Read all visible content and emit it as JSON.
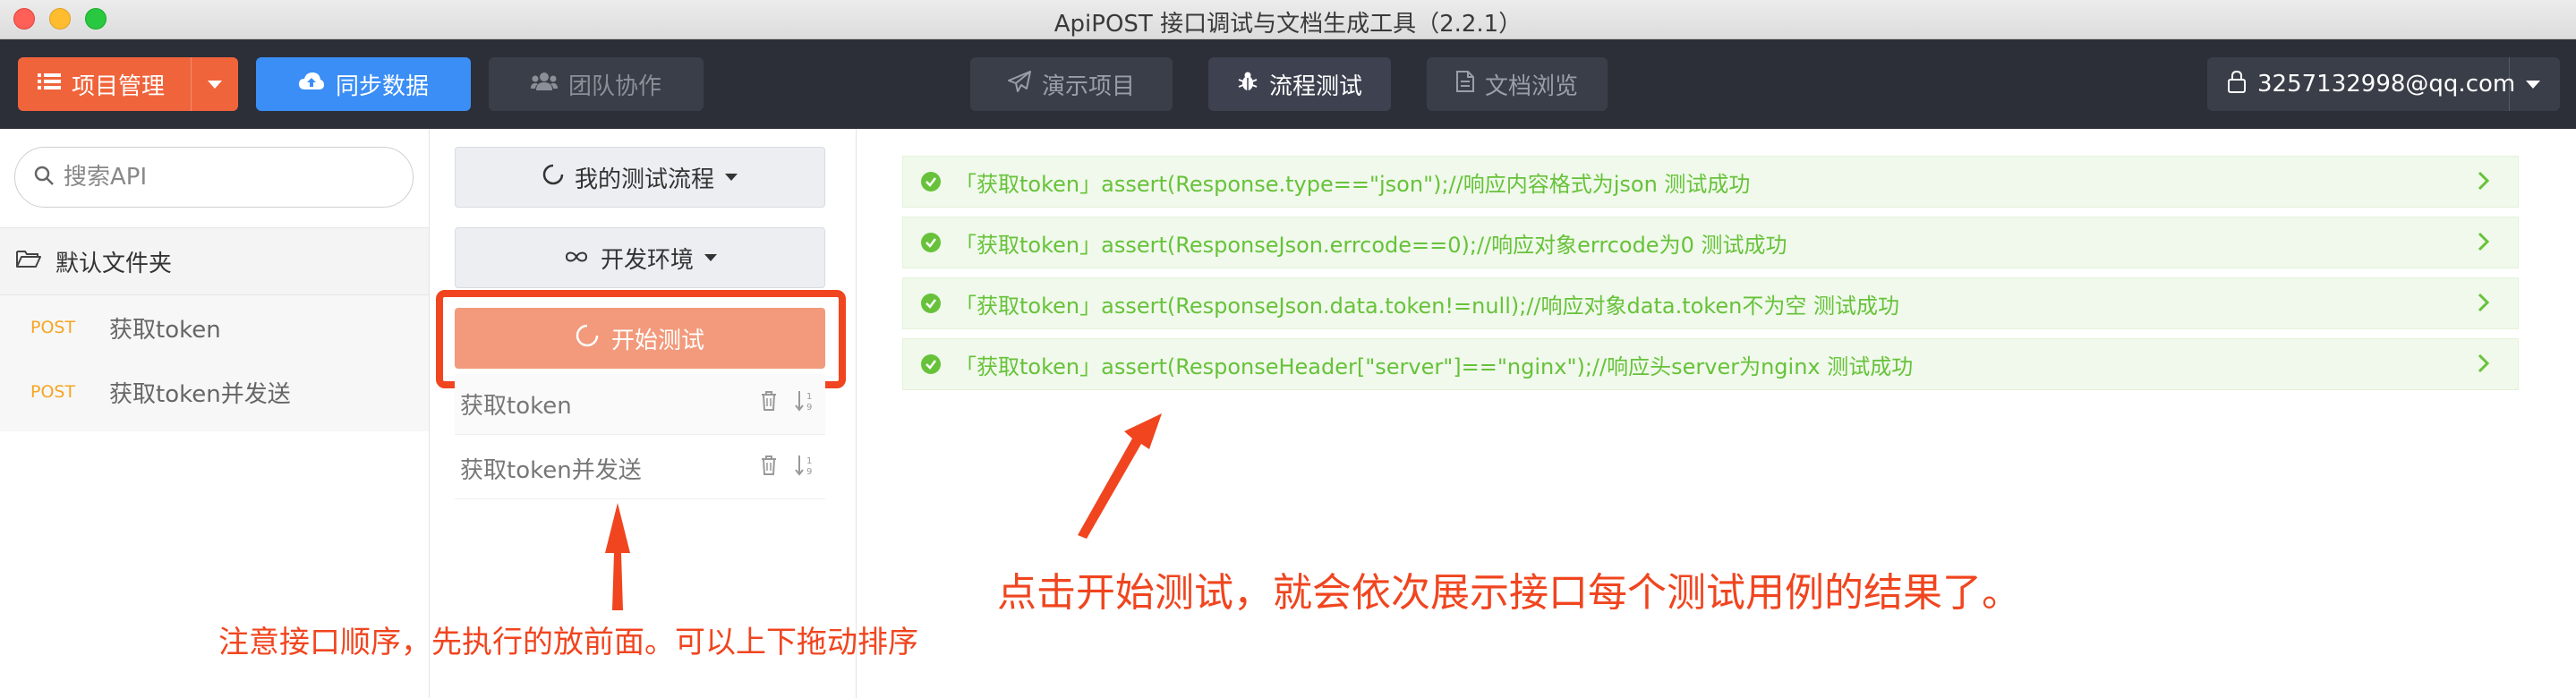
{
  "window": {
    "title": "ApiPOST 接口调试与文档生成工具（2.2.1）"
  },
  "toolbar": {
    "project_label": "项目管理",
    "sync_label": "同步数据",
    "team_label": "团队协作",
    "demo_label": "演示项目",
    "flow_label": "流程测试",
    "docs_label": "文档浏览",
    "user_email": "3257132998@qq.com"
  },
  "sidebar": {
    "search_placeholder": "搜索API",
    "folder_label": "默认文件夹",
    "apis": [
      {
        "method": "POST",
        "name": "获取token"
      },
      {
        "method": "POST",
        "name": "获取token并发送"
      }
    ]
  },
  "flow": {
    "flow_select_label": "我的测试流程",
    "env_select_label": "开发环境",
    "start_label": "开始测试",
    "steps": [
      {
        "name": "获取token"
      },
      {
        "name": "获取token并发送"
      }
    ]
  },
  "results": [
    {
      "text": "「获取token」assert(Response.type==\"json\");//响应内容格式为json 测试成功"
    },
    {
      "text": "「获取token」assert(ResponseJson.errcode==0);//响应对象errcode为0 测试成功"
    },
    {
      "text": "「获取token」assert(ResponseJson.data.token!=null);//响应对象data.token不为空 测试成功"
    },
    {
      "text": "「获取token」assert(ResponseHeader[\"server\"]==\"nginx\");//响应头server为nginx 测试成功"
    }
  ],
  "annotations": {
    "order_note": "注意接口顺序，先执行的放前面。可以上下拖动排序",
    "result_note": "点击开始测试，就会依次展示接口每个测试用例的结果了。"
  },
  "colors": {
    "accent_orange": "#f0643b",
    "sync_blue": "#3a8ef6",
    "success_green": "#67c23a",
    "annotation_red": "#f0451f",
    "toolbar_bg": "#2c2f38"
  }
}
